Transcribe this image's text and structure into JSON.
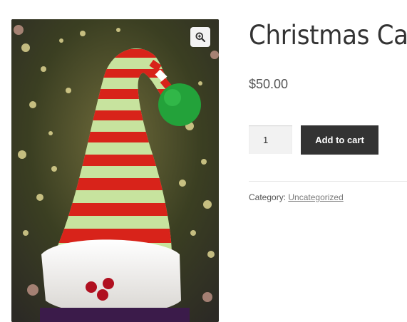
{
  "product": {
    "title": "Christmas Cap",
    "price": "$50.00",
    "quantity": "1",
    "add_to_cart_label": "Add to cart",
    "category_label": "Category:",
    "category_link": "Uncategorized"
  },
  "gallery": {
    "zoom_icon": "magnifier-plus-icon",
    "image_subject": "knitted-elf-hat-photo"
  },
  "colors": {
    "button_bg": "#333333",
    "stripe_red": "#d8231a",
    "stripe_green": "#c7e39e",
    "pompom": "#23a23a"
  }
}
